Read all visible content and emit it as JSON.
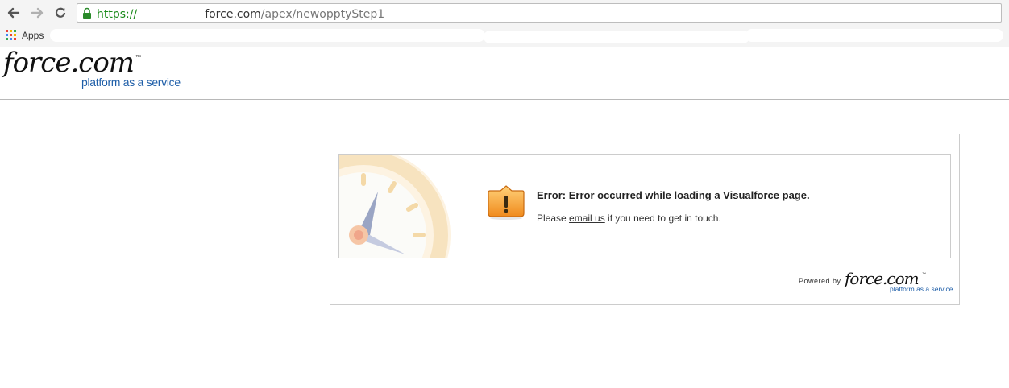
{
  "browser": {
    "url": {
      "scheme": "https://",
      "domain": "force.com",
      "path": "/apex/newopptyStep1"
    },
    "bookmarks": {
      "apps_label": "Apps"
    }
  },
  "header": {
    "logo_brand": "force.com",
    "logo_tm": "™",
    "logo_tagline": "platform as a service"
  },
  "error": {
    "title": "Error: Error occurred while loading a Visualforce page.",
    "message_prefix": "Please ",
    "message_link": "email us",
    "message_suffix": " if you need to get in touch."
  },
  "footer": {
    "powered_by": "Powered by",
    "brand": "force.com",
    "tm": "™",
    "tagline": "platform as a service"
  },
  "colors": {
    "brand_blue": "#1e5ea8",
    "warning_orange": "#f0a030",
    "url_green": "#1a8a1a"
  },
  "icons": [
    "back-arrow-icon",
    "forward-arrow-icon",
    "reload-icon",
    "lock-icon",
    "apps-grid-icon",
    "warning-icon",
    "clock-icon"
  ]
}
